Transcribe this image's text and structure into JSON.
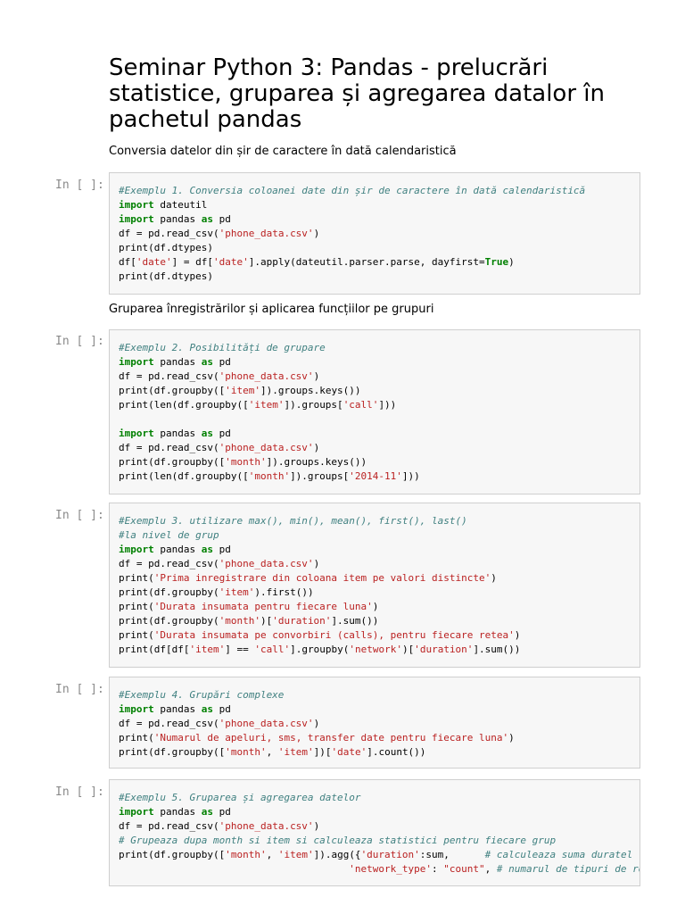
{
  "notebook": {
    "title": "Seminar Python 3: Pandas - prelucrări statistice, gruparea și agregarea datalor în pachetul pandas",
    "md1": "Conversia datelor din șir de caractere în dată calendaristică",
    "md2": "Gruparea înregistrărilor și aplicarea funcțiilor pe grupuri"
  },
  "cells": [
    {
      "prompt": "In [ ]:",
      "lines": [
        [
          {
            "t": "#Exemplu 1. Conversia coloanei date din șir de caractere în dată calendaristică",
            "c": "cm"
          }
        ],
        [
          {
            "t": "import",
            "c": "kw"
          },
          {
            "t": " dateutil",
            "c": ""
          }
        ],
        [
          {
            "t": "import",
            "c": "kw"
          },
          {
            "t": " pandas ",
            "c": ""
          },
          {
            "t": "as",
            "c": "kw"
          },
          {
            "t": " pd",
            "c": ""
          }
        ],
        [
          {
            "t": "df = pd.read_csv(",
            "c": ""
          },
          {
            "t": "'phone_data.csv'",
            "c": "str"
          },
          {
            "t": ")",
            "c": ""
          }
        ],
        [
          {
            "t": "print(df.dtypes)",
            "c": ""
          }
        ],
        [
          {
            "t": "df[",
            "c": ""
          },
          {
            "t": "'date'",
            "c": "str"
          },
          {
            "t": "] = df[",
            "c": ""
          },
          {
            "t": "'date'",
            "c": "str"
          },
          {
            "t": "].apply(dateutil.parser.parse, dayfirst=",
            "c": ""
          },
          {
            "t": "True",
            "c": "kw"
          },
          {
            "t": ")",
            "c": ""
          }
        ],
        [
          {
            "t": "print(df.dtypes)",
            "c": ""
          }
        ]
      ]
    },
    {
      "prompt": "In [ ]:",
      "lines": [
        [
          {
            "t": "#Exemplu 2. Posibilități de grupare",
            "c": "cm"
          }
        ],
        [
          {
            "t": "import",
            "c": "kw"
          },
          {
            "t": " pandas ",
            "c": ""
          },
          {
            "t": "as",
            "c": "kw"
          },
          {
            "t": " pd",
            "c": ""
          }
        ],
        [
          {
            "t": "df = pd.read_csv(",
            "c": ""
          },
          {
            "t": "'phone_data.csv'",
            "c": "str"
          },
          {
            "t": ")",
            "c": ""
          }
        ],
        [
          {
            "t": "print(df.groupby([",
            "c": ""
          },
          {
            "t": "'item'",
            "c": "str"
          },
          {
            "t": "]).groups.keys())",
            "c": ""
          }
        ],
        [
          {
            "t": "print(len(df.groupby([",
            "c": ""
          },
          {
            "t": "'item'",
            "c": "str"
          },
          {
            "t": "]).groups[",
            "c": ""
          },
          {
            "t": "'call'",
            "c": "str"
          },
          {
            "t": "]))",
            "c": ""
          }
        ],
        [],
        [
          {
            "t": "import",
            "c": "kw"
          },
          {
            "t": " pandas ",
            "c": ""
          },
          {
            "t": "as",
            "c": "kw"
          },
          {
            "t": " pd",
            "c": ""
          }
        ],
        [
          {
            "t": "df = pd.read_csv(",
            "c": ""
          },
          {
            "t": "'phone_data.csv'",
            "c": "str"
          },
          {
            "t": ")",
            "c": ""
          }
        ],
        [
          {
            "t": "print(df.groupby([",
            "c": ""
          },
          {
            "t": "'month'",
            "c": "str"
          },
          {
            "t": "]).groups.keys())",
            "c": ""
          }
        ],
        [
          {
            "t": "print(len(df.groupby([",
            "c": ""
          },
          {
            "t": "'month'",
            "c": "str"
          },
          {
            "t": "]).groups[",
            "c": ""
          },
          {
            "t": "'2014-11'",
            "c": "str"
          },
          {
            "t": "]))",
            "c": ""
          }
        ]
      ]
    },
    {
      "prompt": "In [ ]:",
      "lines": [
        [
          {
            "t": "#Exemplu 3. utilizare max(), min(), mean(), first(), last()",
            "c": "cm"
          }
        ],
        [
          {
            "t": "#la nivel de grup",
            "c": "cm"
          }
        ],
        [
          {
            "t": "import",
            "c": "kw"
          },
          {
            "t": " pandas ",
            "c": ""
          },
          {
            "t": "as",
            "c": "kw"
          },
          {
            "t": " pd",
            "c": ""
          }
        ],
        [
          {
            "t": "df = pd.read_csv(",
            "c": ""
          },
          {
            "t": "'phone_data.csv'",
            "c": "str"
          },
          {
            "t": ")",
            "c": ""
          }
        ],
        [
          {
            "t": "print(",
            "c": ""
          },
          {
            "t": "'Prima inregistrare din coloana item pe valori distincte'",
            "c": "str"
          },
          {
            "t": ")",
            "c": ""
          }
        ],
        [
          {
            "t": "print(df.groupby(",
            "c": ""
          },
          {
            "t": "'item'",
            "c": "str"
          },
          {
            "t": ").first())",
            "c": ""
          }
        ],
        [
          {
            "t": "print(",
            "c": ""
          },
          {
            "t": "'Durata insumata pentru fiecare luna'",
            "c": "str"
          },
          {
            "t": ")",
            "c": ""
          }
        ],
        [
          {
            "t": "print(df.groupby(",
            "c": ""
          },
          {
            "t": "'month'",
            "c": "str"
          },
          {
            "t": ")[",
            "c": ""
          },
          {
            "t": "'duration'",
            "c": "str"
          },
          {
            "t": "].sum())",
            "c": ""
          }
        ],
        [
          {
            "t": "print(",
            "c": ""
          },
          {
            "t": "'Durata insumata pe convorbiri (calls), pentru fiecare retea'",
            "c": "str"
          },
          {
            "t": ")",
            "c": ""
          }
        ],
        [
          {
            "t": "print(df[df[",
            "c": ""
          },
          {
            "t": "'item'",
            "c": "str"
          },
          {
            "t": "] == ",
            "c": ""
          },
          {
            "t": "'call'",
            "c": "str"
          },
          {
            "t": "].groupby(",
            "c": ""
          },
          {
            "t": "'network'",
            "c": "str"
          },
          {
            "t": ")[",
            "c": ""
          },
          {
            "t": "'duration'",
            "c": "str"
          },
          {
            "t": "].sum())",
            "c": ""
          }
        ]
      ]
    },
    {
      "prompt": "In [ ]:",
      "lines": [
        [
          {
            "t": "#Exemplu 4. Grupări complexe",
            "c": "cm"
          }
        ],
        [
          {
            "t": "import",
            "c": "kw"
          },
          {
            "t": " pandas ",
            "c": ""
          },
          {
            "t": "as",
            "c": "kw"
          },
          {
            "t": " pd",
            "c": ""
          }
        ],
        [
          {
            "t": "df = pd.read_csv(",
            "c": ""
          },
          {
            "t": "'phone_data.csv'",
            "c": "str"
          },
          {
            "t": ")",
            "c": ""
          }
        ],
        [
          {
            "t": "print(",
            "c": ""
          },
          {
            "t": "'Numarul de apeluri, sms, transfer date pentru fiecare luna'",
            "c": "str"
          },
          {
            "t": ")",
            "c": ""
          }
        ],
        [
          {
            "t": "print(df.groupby([",
            "c": ""
          },
          {
            "t": "'month'",
            "c": "str"
          },
          {
            "t": ", ",
            "c": ""
          },
          {
            "t": "'item'",
            "c": "str"
          },
          {
            "t": "])[",
            "c": ""
          },
          {
            "t": "'date'",
            "c": "str"
          },
          {
            "t": "].count())",
            "c": ""
          }
        ]
      ]
    },
    {
      "prompt": "In [ ]:",
      "lines": [
        [
          {
            "t": "#Exemplu 5. Gruparea și agregarea datelor",
            "c": "cm"
          }
        ],
        [
          {
            "t": "import",
            "c": "kw"
          },
          {
            "t": " pandas ",
            "c": ""
          },
          {
            "t": "as",
            "c": "kw"
          },
          {
            "t": " pd",
            "c": ""
          }
        ],
        [
          {
            "t": "df = pd.read_csv(",
            "c": ""
          },
          {
            "t": "'phone_data.csv'",
            "c": "str"
          },
          {
            "t": ")",
            "c": ""
          }
        ],
        [
          {
            "t": "# Grupeaza dupa month si item si calculeaza statistici pentru fiecare grup",
            "c": "cm"
          }
        ],
        [
          {
            "t": "print(df.groupby([",
            "c": ""
          },
          {
            "t": "'month'",
            "c": "str"
          },
          {
            "t": ", ",
            "c": ""
          },
          {
            "t": "'item'",
            "c": "str"
          },
          {
            "t": "]).agg({",
            "c": ""
          },
          {
            "t": "'duration'",
            "c": "str"
          },
          {
            "t": ":sum,      ",
            "c": ""
          },
          {
            "t": "# calculeaza suma duratel",
            "c": "cm"
          }
        ],
        [
          {
            "t": "                                       ",
            "c": ""
          },
          {
            "t": "'network_type'",
            "c": "str"
          },
          {
            "t": ": ",
            "c": ""
          },
          {
            "t": "\"count\"",
            "c": "str"
          },
          {
            "t": ", ",
            "c": ""
          },
          {
            "t": "# numarul de tipuri de re",
            "c": "cm"
          }
        ]
      ]
    }
  ]
}
